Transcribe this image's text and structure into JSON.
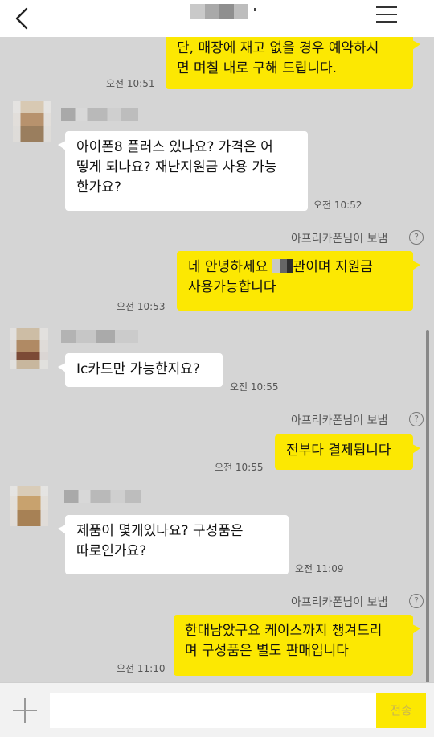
{
  "header": {
    "chat_title": "",
    "back_icon": "chevron-left-icon",
    "menu_icon": "hamburger-menu-icon"
  },
  "messages": [
    {
      "direction": "outgoing",
      "text_line1": "단, 매장에 재고 없을 경우 예약하시",
      "text_line2": "면 며칠 내로 구해 드립니다.",
      "time": "오전 10:51"
    },
    {
      "direction": "incoming",
      "sender": "",
      "text_line1": "아이폰8 플러스 있나요? 가격은 어",
      "text_line2": "떻게 되나요? 재난지원금 사용 가능",
      "text_line3": "한가요?",
      "time": "오전 10:52"
    },
    {
      "direction": "outgoing",
      "sent_by": "아프리카폰님이 보냄",
      "text_pre": "네 안녕하세요 ",
      "text_post": "관이며 지원금",
      "text_line2": "사용가능합니다",
      "time": "오전 10:53"
    },
    {
      "direction": "incoming",
      "sender": "",
      "text": "Ic카드만 가능한지요?",
      "time": "오전 10:55"
    },
    {
      "direction": "outgoing",
      "sent_by": "아프리카폰님이 보냄",
      "text": "전부다 결제됩니다",
      "time": "오전 10:55"
    },
    {
      "direction": "incoming",
      "sender": "",
      "text_line1": "제품이 몇개있나요? 구성품은",
      "text_line2": "따로인가요?",
      "time": "오전 11:09"
    },
    {
      "direction": "outgoing",
      "sent_by": "아프리카폰님이 보냄",
      "text_line1": "한대남았구요 케이스까지 챙겨드리",
      "text_line2": "며 구성품은 별도 판매입니다",
      "time": "오전 11:10"
    }
  ],
  "help_glyph": "?",
  "input": {
    "placeholder": "",
    "send_label": "전송",
    "plus_icon": "plus-icon"
  },
  "colors": {
    "outgoing_bubble": "#fce802",
    "incoming_bubble": "#ffffff",
    "background": "#d5d5d5"
  }
}
